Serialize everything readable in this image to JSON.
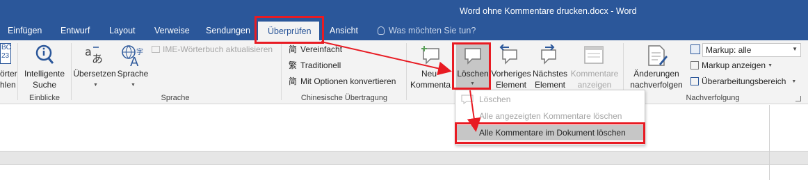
{
  "window": {
    "title": "Word ohne Kommentare drucken.docx - Word"
  },
  "tabs": [
    {
      "label": "Einfügen"
    },
    {
      "label": "Entwurf"
    },
    {
      "label": "Layout"
    },
    {
      "label": "Verweise"
    },
    {
      "label": "Sendungen"
    },
    {
      "label": "Überprüfen",
      "active": true
    },
    {
      "label": "Ansicht"
    }
  ],
  "tell_me": {
    "placeholder": "Was möchten Sie tun?"
  },
  "ribbon": {
    "proofing_partial": {
      "label1": "örter",
      "label2": "hlen",
      "icon_text1": "BC",
      "icon_text2": "23"
    },
    "insights": {
      "button_label1": "Intelligente",
      "button_label2": "Suche",
      "group_label": "Einblicke"
    },
    "language": {
      "translate_label": "Übersetzen",
      "language_label": "Sprache",
      "ime_label": "IME-Wörterbuch aktualisieren",
      "group_label": "Sprache"
    },
    "chinese": {
      "simplified": "Vereinfacht",
      "traditional": "Traditionell",
      "options": "Mit Optionen konvertieren",
      "group_label": "Chinesische Übertragung"
    },
    "comments": {
      "new_label1": "Neu",
      "new_label2": "Kommenta",
      "delete_label": "Löschen",
      "previous_label1": "Vorheriges",
      "previous_label2": "Element",
      "next_label1": "Nächstes",
      "next_label2": "Element",
      "show_label1": "Kommentare",
      "show_label2": "anzeigen"
    },
    "tracking": {
      "track_label1": "Änderungen",
      "track_label2": "nachverfolgen",
      "markup_value": "Markup: alle",
      "show_markup": "Markup anzeigen",
      "review_pane": "Überarbeitungsbereich",
      "group_label": "Nachverfolgung"
    }
  },
  "delete_menu": {
    "items": [
      {
        "label": "Löschen",
        "enabled": false
      },
      {
        "label": "Alle angezeigten Kommentare löschen",
        "enabled": false
      },
      {
        "label": "Alle Kommentare im Dokument löschen",
        "enabled": true,
        "highlighted": true
      }
    ]
  },
  "colors": {
    "accent": "#2b579a",
    "annotation": "#e81b23",
    "ribbon_bg": "#f3f3f3"
  }
}
